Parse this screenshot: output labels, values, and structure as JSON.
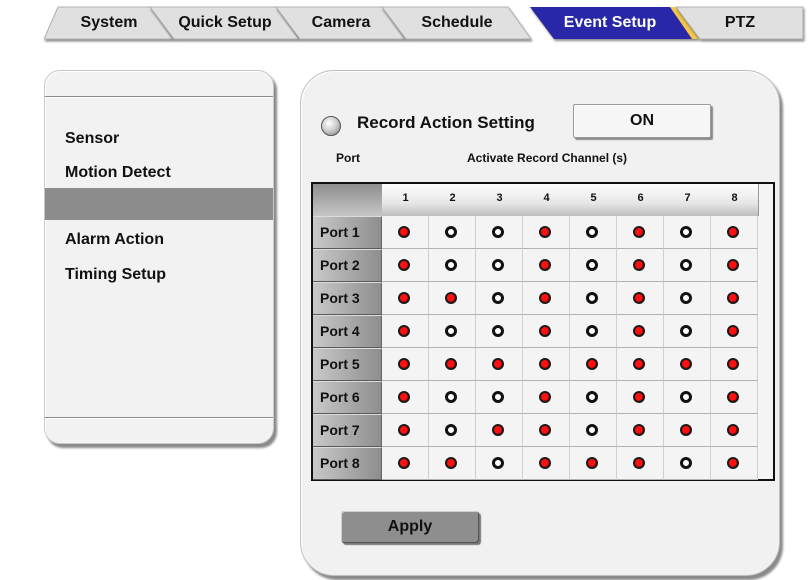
{
  "tabs": [
    {
      "label": "System",
      "active": false
    },
    {
      "label": "Quick Setup",
      "active": false
    },
    {
      "label": "Camera",
      "active": false
    },
    {
      "label": "Schedule",
      "active": false
    },
    {
      "label": "Event Setup",
      "active": true
    },
    {
      "label": "PTZ",
      "active": false
    }
  ],
  "colors": {
    "tab_bg": "#e0e0e0",
    "active_tab_bg": "#2727a8",
    "active_tab_accent": "#f4c64a",
    "dot_on": "#e00000",
    "selected_menu_bg": "#8d8d8d"
  },
  "menu": {
    "items": [
      {
        "label": "Sensor"
      },
      {
        "label": "Motion Detect"
      },
      {
        "label": ""
      },
      {
        "label": "Alarm Action"
      },
      {
        "label": "Timing Setup"
      }
    ],
    "selected_index": 2
  },
  "record_action": {
    "label": "Record Action Setting",
    "toggle_value": "ON"
  },
  "grid": {
    "port_header": "Port",
    "channel_header": "Activate Record Channel (s)",
    "channels": [
      "1",
      "2",
      "3",
      "4",
      "5",
      "6",
      "7",
      "8"
    ],
    "rows": [
      {
        "port": "Port 1",
        "states": [
          1,
          0,
          0,
          1,
          0,
          1,
          0,
          1
        ]
      },
      {
        "port": "Port 2",
        "states": [
          1,
          0,
          0,
          1,
          0,
          1,
          0,
          1
        ]
      },
      {
        "port": "Port 3",
        "states": [
          1,
          1,
          0,
          1,
          0,
          1,
          0,
          1
        ]
      },
      {
        "port": "Port 4",
        "states": [
          1,
          0,
          0,
          1,
          0,
          1,
          0,
          1
        ]
      },
      {
        "port": "Port 5",
        "states": [
          1,
          1,
          1,
          1,
          1,
          1,
          1,
          1
        ]
      },
      {
        "port": "Port 6",
        "states": [
          1,
          0,
          0,
          1,
          0,
          1,
          0,
          1
        ]
      },
      {
        "port": "Port 7",
        "states": [
          1,
          0,
          1,
          1,
          0,
          1,
          1,
          1
        ]
      },
      {
        "port": "Port 8",
        "states": [
          1,
          1,
          0,
          1,
          1,
          1,
          0,
          1
        ]
      }
    ]
  },
  "apply_label": "Apply"
}
